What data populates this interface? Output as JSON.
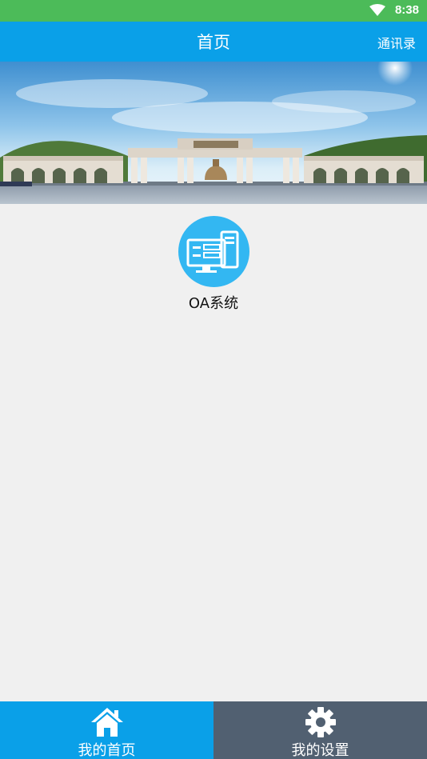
{
  "status_bar": {
    "time": "8:38",
    "wifi_icon": "wifi-icon"
  },
  "header": {
    "title": "首页",
    "contacts_label": "通讯录"
  },
  "banner": {
    "image": "campus-gate-photo"
  },
  "apps": [
    {
      "label": "OA系统",
      "icon": "oa-computer-icon"
    }
  ],
  "tabbar": {
    "home_label": "我的首页",
    "settings_label": "我的设置",
    "home_icon": "home-icon",
    "settings_icon": "gear-icon"
  },
  "colors": {
    "status_bar": "#4cbb59",
    "primary": "#0aa0e8",
    "tab_inactive": "#516071",
    "app_icon_bg": "#33b7f2",
    "background": "#f0f0f0"
  }
}
